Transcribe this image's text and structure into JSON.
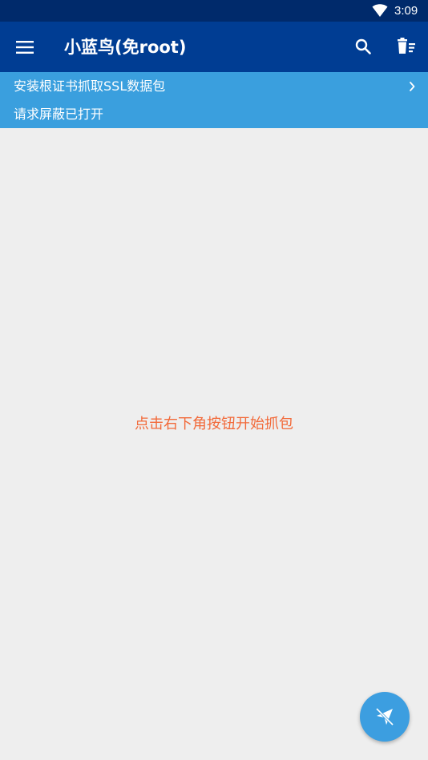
{
  "status_bar": {
    "time": "3:09",
    "wifi_icon": "wifi-icon"
  },
  "app_bar": {
    "title": "小蓝鸟(免root)",
    "menu_icon": "menu-icon",
    "search_icon": "search-icon",
    "clear_icon": "clear-list-icon",
    "background_color": "#003d93"
  },
  "banner": {
    "cert_text": "安装根证书抓取SSL数据包",
    "block_text": "请求屏蔽已打开",
    "chevron_icon": "chevron-right-icon",
    "background_color": "#3a9fde"
  },
  "main": {
    "hint_text": "点击右下角按钮开始抓包",
    "hint_color": "#f26a3a"
  },
  "fab": {
    "icon": "send-off-icon",
    "color": "#3c9ee0"
  }
}
